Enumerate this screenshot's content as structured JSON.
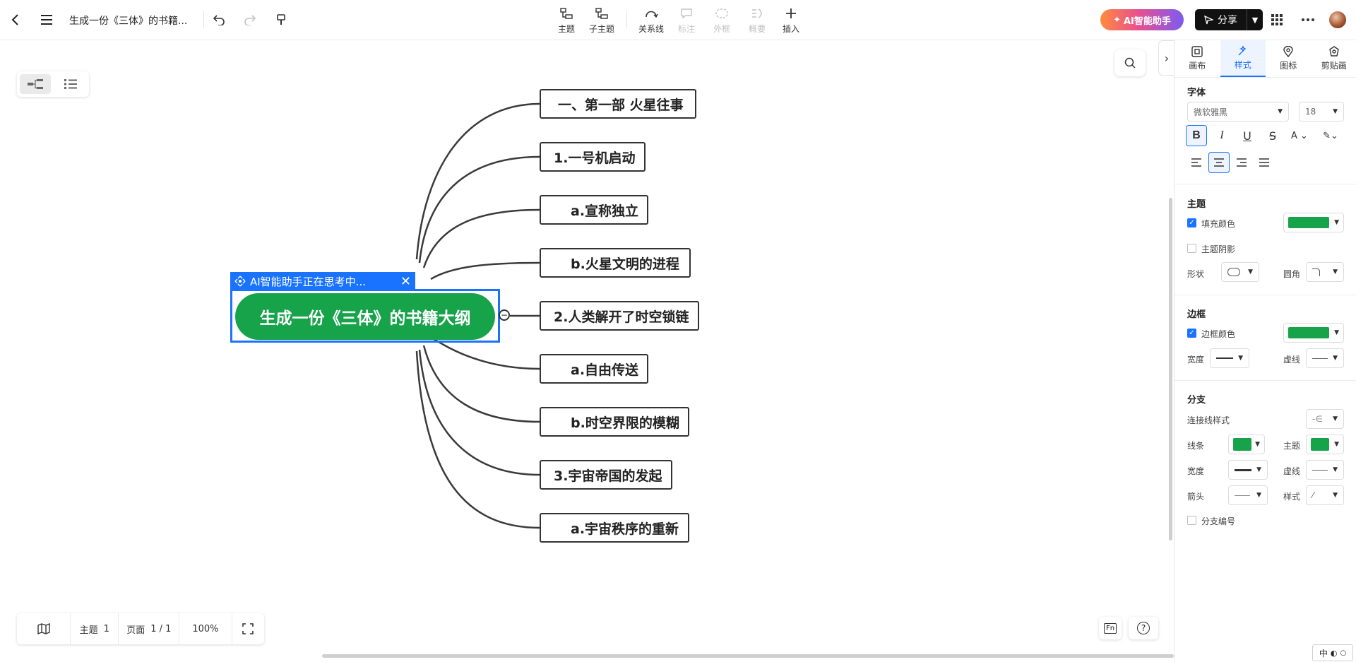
{
  "header": {
    "doc_title": "生成一份《三体》的书籍...",
    "tools": [
      {
        "label": "主题",
        "disabled": false
      },
      {
        "label": "子主题",
        "disabled": false
      },
      {
        "label": "关系线",
        "disabled": false
      },
      {
        "label": "标注",
        "disabled": true
      },
      {
        "label": "外框",
        "disabled": true
      },
      {
        "label": "概要",
        "disabled": true
      },
      {
        "label": "插入",
        "disabled": false
      }
    ],
    "ai_button": "AI智能助手",
    "share_button": "分享"
  },
  "mindmap": {
    "root": "生成一份《三体》的书籍大纲",
    "ai_status": "AI智能助手正在思考中...",
    "children": [
      "一、第一部 火星往事",
      "1.一号机启动",
      "a.宣称独立",
      "b.火星文明的进程",
      "2.人类解开了时空锁链",
      "a.自由传送",
      "b.时空界限的模糊",
      "3.宇宙帝国的发起",
      "a.宇宙秩序的重新"
    ],
    "theme_color": "#16a34a",
    "selection_color": "#1a73ff"
  },
  "bottombar": {
    "topic_label": "主题",
    "topic_count": "1",
    "page_label": "页面",
    "page_value": "1 / 1",
    "zoom": "100%",
    "fn_label": "Fn",
    "help_label": "?"
  },
  "panel": {
    "tabs": [
      {
        "label": "画布",
        "icon": "canvas-icon"
      },
      {
        "label": "样式",
        "icon": "style-icon"
      },
      {
        "label": "图标",
        "icon": "marker-icon"
      },
      {
        "label": "剪贴画",
        "icon": "clipart-icon"
      }
    ],
    "active_tab": "样式",
    "font": {
      "title": "字体",
      "family": "微软雅黑",
      "size": "18",
      "bold": true
    },
    "topic": {
      "title": "主题",
      "fill_label": "填充颜色",
      "fill_checked": true,
      "fill_color": "#16a34a",
      "shadow_label": "主题阴影",
      "shadow_checked": false,
      "shape_label": "形状",
      "corner_label": "圆角"
    },
    "border": {
      "title": "边框",
      "color_label": "边框颜色",
      "color_checked": true,
      "color": "#16a34a",
      "width_label": "宽度",
      "dash_label": "虚线"
    },
    "branch": {
      "title": "分支",
      "connector_label": "连接线样式",
      "line_label": "线条",
      "line_color": "#16a34a",
      "topic_label": "主题",
      "topic_color": "#16a34a",
      "width_label": "宽度",
      "dash_label": "虚线",
      "arrow_label": "箭头",
      "style_label": "样式",
      "numbering_label": "分支编号",
      "numbering_checked": false
    }
  },
  "ime": "中"
}
